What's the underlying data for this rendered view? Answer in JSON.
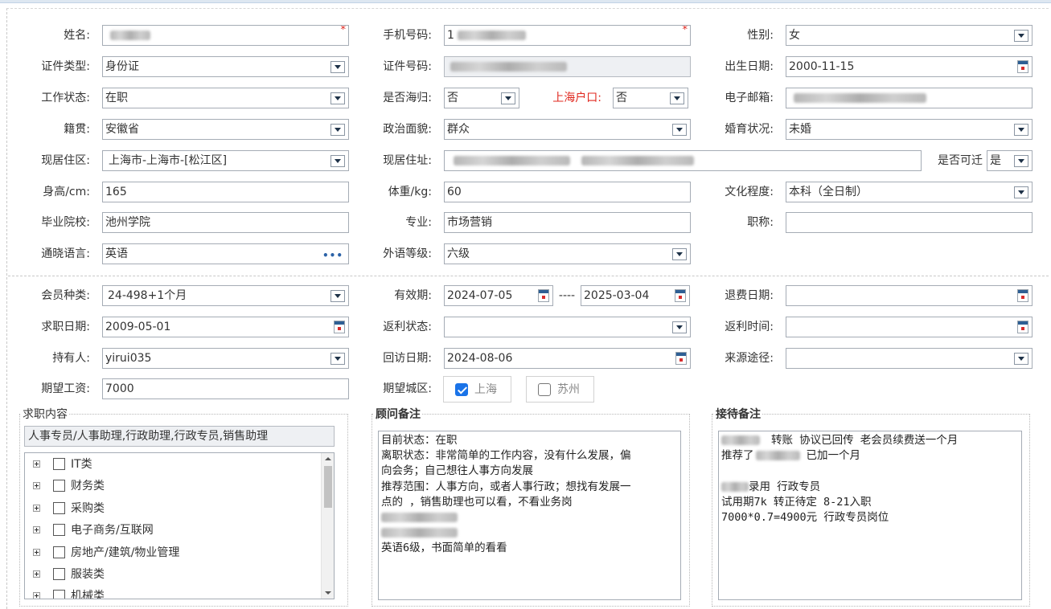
{
  "form": {
    "name": {
      "label": "姓名:",
      "value": ""
    },
    "mobile": {
      "label": "手机号码:",
      "value": "1"
    },
    "gender": {
      "label": "性别:",
      "value": "女"
    },
    "id_type": {
      "label": "证件类型:",
      "value": "身份证"
    },
    "id_number": {
      "label": "证件号码:",
      "value": ""
    },
    "birth_date": {
      "label": "出生日期:",
      "value": "2000-11-15"
    },
    "work_status": {
      "label": "工作状态:",
      "value": "在职"
    },
    "overseas_returnee": {
      "label": "是否海归:",
      "value": "否"
    },
    "shanghai_hukou": {
      "label": "上海户口:",
      "value": "否"
    },
    "email": {
      "label": "电子邮箱:",
      "value": ""
    },
    "native_place": {
      "label": "籍贯:",
      "value": "安徽省"
    },
    "political_status": {
      "label": "政治面貌:",
      "value": "群众"
    },
    "marital_status": {
      "label": "婚育状况:",
      "value": "未婚"
    },
    "residence_district": {
      "label": "现居住区:",
      "value": "上海市-上海市-[松江区]"
    },
    "address": {
      "label": "现居住址:",
      "value": ""
    },
    "can_relocate": {
      "label": "是否可迁",
      "value": "是"
    },
    "height": {
      "label": "身高/cm:",
      "value": "165"
    },
    "weight": {
      "label": "体重/kg:",
      "value": "60"
    },
    "education": {
      "label": "文化程度:",
      "value": "本科（全日制）"
    },
    "school": {
      "label": "毕业院校:",
      "value": "池州学院"
    },
    "major": {
      "label": "专业:",
      "value": "市场营销"
    },
    "title": {
      "label": "职称:",
      "value": ""
    },
    "languages": {
      "label": "通晓语言:",
      "value": "英语"
    },
    "foreign_level": {
      "label": "外语等级:",
      "value": "六级"
    }
  },
  "membership": {
    "member_type": {
      "label": "会员种类:",
      "value": "24-498+1个月"
    },
    "valid_period": {
      "label": "有效期:",
      "start": "2024-07-05",
      "separator": "----",
      "end": "2025-03-04"
    },
    "refund_date": {
      "label": "退费日期:",
      "value": ""
    },
    "job_date": {
      "label": "求职日期:",
      "value": "2009-05-01"
    },
    "rebate_status": {
      "label": "返利状态:",
      "value": ""
    },
    "rebate_time": {
      "label": "返利时间:",
      "value": ""
    },
    "holder": {
      "label": "持有人:",
      "value": "yirui035"
    },
    "visit_date": {
      "label": "回访日期:",
      "value": "2024-08-06"
    },
    "source": {
      "label": "来源途径:",
      "value": ""
    },
    "salary": {
      "label": "期望工资:",
      "value": "7000"
    },
    "city": {
      "label": "期望城区:",
      "options": [
        {
          "label": "上海",
          "checked": true
        },
        {
          "label": "苏州",
          "checked": false
        }
      ]
    }
  },
  "job_content": {
    "title": "求职内容",
    "summary": "人事专员/人事助理,行政助理,行政专员,销售助理",
    "categories": [
      "IT类",
      "财务类",
      "采购类",
      "电子商务/互联网",
      "房地产/建筑/物业管理",
      "服装类",
      "机械类"
    ]
  },
  "consultant_notes": {
    "title": "顾问备注",
    "lines": [
      "目前状态：在职",
      "离职状态：非常简单的工作内容，没有什么发展，偏",
      "向会务；自己想往人事方向发展",
      "推荐范围：人事方向，或者人事行政；想找有发展一",
      "点的 ，销售助理也可以看，不看业务岗",
      "",
      "",
      "英语6级，书面简单的看看"
    ]
  },
  "reception_notes": {
    "title": "接待备注",
    "lines": [
      "转账 协议已回传  老会员续费送一个月",
      "推荐了",
      "已加一个月",
      "",
      "录用 行政专员",
      "试用期7k 转正待定  8-21入职",
      "7000*0.7=4900元 行政专员岗位"
    ]
  }
}
